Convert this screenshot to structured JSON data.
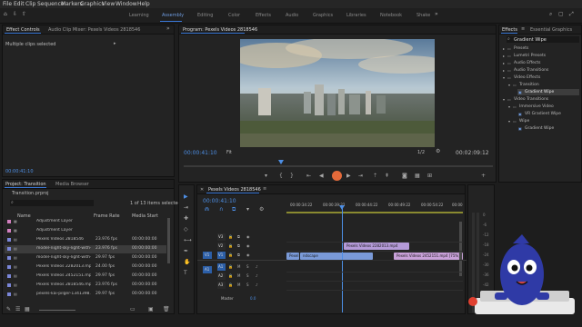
{
  "menubar": {
    "items": [
      "File",
      "Edit",
      "Clip",
      "Sequence",
      "Markers",
      "Graphics",
      "View",
      "Window",
      "Help"
    ]
  },
  "workspaces": {
    "tabs": [
      "Learning",
      "Assembly",
      "Editing",
      "Color",
      "Effects",
      "Audio",
      "Graphics",
      "Libraries",
      "Notebook",
      "Shake"
    ],
    "active": "Assembly"
  },
  "effect_controls": {
    "tabs": [
      "Effect Controls",
      "Audio Clip Mixer: Pexels Videos 2818546"
    ],
    "message": "Multiple clips selected",
    "timecode": "00:00:41:10"
  },
  "program": {
    "title": "Program: Pexels Videos 2818546",
    "timecode_current": "00:00:41:10",
    "fit": "Fit",
    "ratio": "1/2",
    "timecode_duration": "00:02:09:12"
  },
  "project": {
    "tabs": [
      "Project: Transition",
      "Media Browser"
    ],
    "filename": "Transition.prproj",
    "count": "1 of 13 items selected",
    "col_name": "Name",
    "col_rate": "Frame Rate",
    "col_start": "Media Start",
    "items": [
      {
        "name": "Adjustment Layer",
        "rate": "",
        "start": "",
        "color": "#d27fc0"
      },
      {
        "name": "Adjustment Layer",
        "rate": "",
        "start": "",
        "color": "#d27fc0"
      },
      {
        "name": "Pexels Videos 2818546",
        "rate": "23.976 fps",
        "start": "00:00:00:00",
        "color": "#7a86d8"
      },
      {
        "name": "model-night-sky-light-with-...",
        "rate": "23.976 fps",
        "start": "00:00:00:00",
        "color": "#7a86d8"
      },
      {
        "name": "model-night-sky-light-with-...",
        "rate": "29.97 fps",
        "start": "00:00:00:00",
        "color": "#7a86d8"
      },
      {
        "name": "Pexels Videos 2282013.mp4",
        "rate": "24.00 fps",
        "start": "00:00:00:00",
        "color": "#7a86d8"
      },
      {
        "name": "Pexels Videos 2452151.mp4",
        "rate": "29.97 fps",
        "start": "00:00:00:00",
        "color": "#7a86d8"
      },
      {
        "name": "Pexels Videos 2818546.mp4",
        "rate": "23.976 fps",
        "start": "00:00:00:00",
        "color": "#7a86d8"
      },
      {
        "name": "pexels-kai-pilger-1341398...",
        "rate": "29.97 fps",
        "start": "00:00:00:00",
        "color": "#7a86d8"
      }
    ]
  },
  "sequence": {
    "title": "Pexels Videos 2818546",
    "timecode": "00:00:41:10",
    "ruler": [
      "00:00:34:22",
      "00:00:39:22",
      "00:00:44:22",
      "00:00:49:22",
      "00:00:54:22",
      "00:00"
    ],
    "video_tracks": [
      "V3",
      "V2",
      "V1"
    ],
    "audio_tracks": [
      "A1",
      "A2",
      "A3"
    ],
    "source_v": "V1",
    "source_a": "A1",
    "master_label": "Master",
    "master_value": "0.0",
    "clips": [
      {
        "label": "Pexels Videos 2282013.mp4",
        "color": "#b49ad8"
      },
      {
        "label": "Pexel",
        "color": "#7a9ad8"
      },
      {
        "label": "ndscape",
        "color": "#7a9ad8"
      },
      {
        "label": "Pexels Videos 2452151.mp4 [75%]",
        "color": "#c8a0d8"
      }
    ]
  },
  "effects": {
    "tabs": [
      "Effects",
      "Essential Graphics"
    ],
    "search": "Gradient Wipe",
    "tree": [
      {
        "label": "Presets",
        "level": 0,
        "open": false,
        "highlight": false
      },
      {
        "label": "Lumetri Presets",
        "level": 0,
        "open": false,
        "highlight": false
      },
      {
        "label": "Audio Effects",
        "level": 0,
        "open": false,
        "highlight": false
      },
      {
        "label": "Audio Transitions",
        "level": 0,
        "open": false,
        "highlight": false
      },
      {
        "label": "Video Effects",
        "level": 0,
        "open": true,
        "highlight": false
      },
      {
        "label": "Transition",
        "level": 1,
        "open": true,
        "highlight": false
      },
      {
        "label": "Gradient Wipe",
        "level": 2,
        "open": false,
        "highlight": true
      },
      {
        "label": "Video Transitions",
        "level": 0,
        "open": true,
        "highlight": false
      },
      {
        "label": "Immersive Video",
        "level": 1,
        "open": true,
        "highlight": false
      },
      {
        "label": "VR Gradient Wipe",
        "level": 2,
        "open": false,
        "highlight": false
      },
      {
        "label": "Wipe",
        "level": 1,
        "open": true,
        "highlight": false
      },
      {
        "label": "Gradient Wipe",
        "level": 2,
        "open": false,
        "highlight": false
      }
    ]
  },
  "meters": [
    "0",
    "-6",
    "-12",
    "-18",
    "-24",
    "-30",
    "-36",
    "-42",
    "-48",
    "-54"
  ]
}
